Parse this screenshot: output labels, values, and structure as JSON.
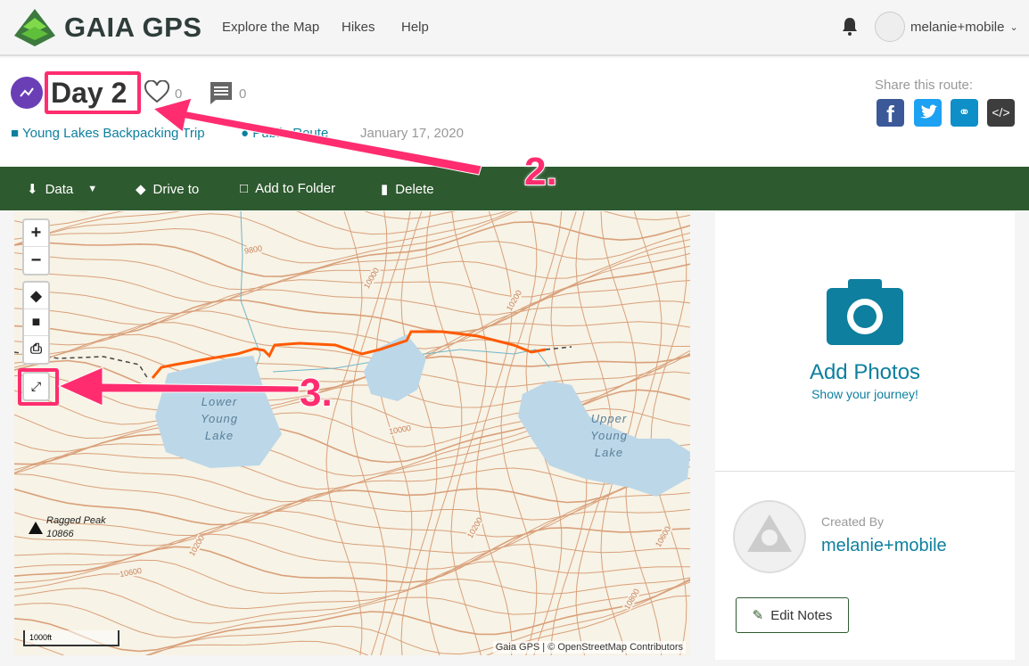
{
  "nav": {
    "brand": "GAIA GPS",
    "links": [
      "Explore the Map",
      "Hikes",
      "Help"
    ],
    "username": "melanie+mobile"
  },
  "route": {
    "title": "Day 2",
    "likes": "0",
    "comments": "0",
    "folder": "Young Lakes Backpacking Trip",
    "visibility": "Public Route",
    "date": "January 17, 2020"
  },
  "share": {
    "label": "Share this route:",
    "buttons": [
      "facebook",
      "twitter",
      "link",
      "embed"
    ]
  },
  "toolbar": {
    "data": "Data",
    "drive": "Drive to",
    "folder": "Add to Folder",
    "delete": "Delete"
  },
  "map": {
    "labels": {
      "lower": [
        "Lower",
        "Young",
        "Lake"
      ],
      "upper": [
        "Upper",
        "Young",
        "Lake"
      ],
      "peak": "Ragged Peak",
      "peak_elev": "10866"
    },
    "contours": [
      "9800",
      "10000",
      "10200",
      "10000",
      "10200",
      "10200",
      "10600",
      "10600",
      "10800"
    ],
    "scale": "1000ft",
    "attribution": "Gaia GPS | © OpenStreetMap Contributors"
  },
  "panel": {
    "add_photos": "Add Photos",
    "show_journey": "Show your journey!",
    "created_by": "Created By",
    "creator": "melanie+mobile",
    "edit_notes": "Edit Notes"
  },
  "annotations": {
    "step2": "2.",
    "step3": "3."
  },
  "colors": {
    "accent": "#0e7f9e",
    "toolbar": "#2e5a2f",
    "highlight": "#ff2d6f",
    "track": "#ff5a00"
  }
}
